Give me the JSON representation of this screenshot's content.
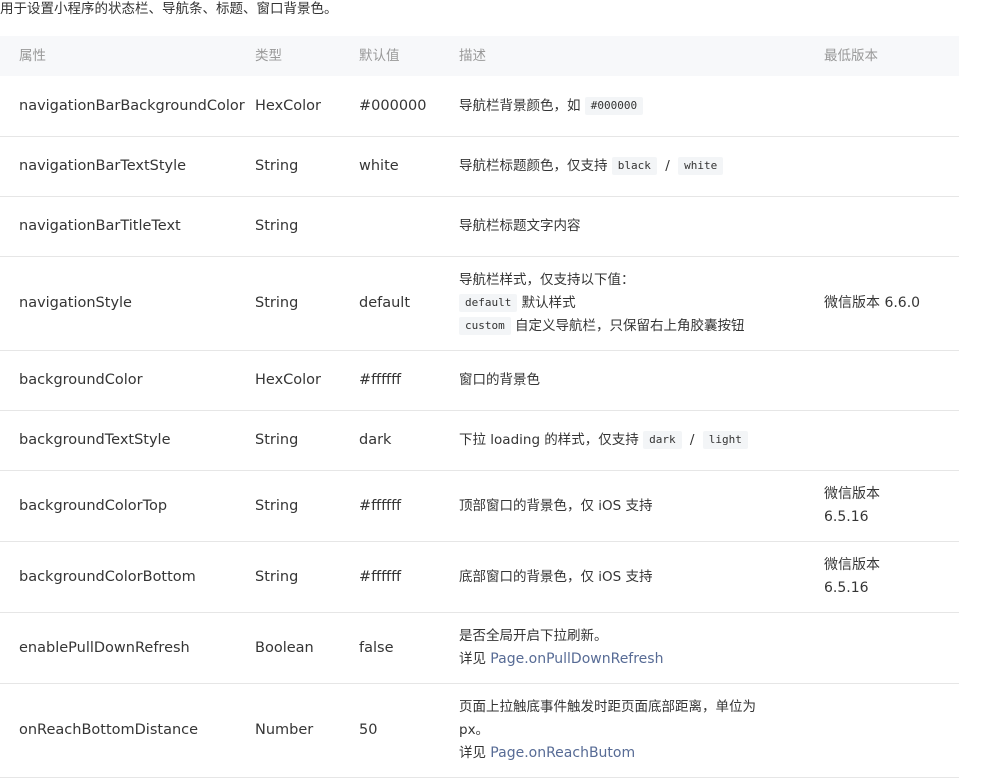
{
  "intro": "用于设置小程序的状态栏、导航条、标题、窗口背景色。",
  "headers": {
    "prop": "属性",
    "type": "类型",
    "default": "默认值",
    "desc": "描述",
    "version": "最低版本"
  },
  "rows": [
    {
      "prop": "navigationBarBackgroundColor",
      "type": "HexColor",
      "default": "#000000",
      "desc_text": "导航栏背景颜色，如",
      "desc_code": "#000000",
      "version": ""
    },
    {
      "prop": "navigationBarTextStyle",
      "type": "String",
      "default": "white",
      "desc_text": "导航栏标题颜色，仅支持",
      "desc_code1": "black",
      "desc_sep": "/",
      "desc_code2": "white",
      "version": ""
    },
    {
      "prop": "navigationBarTitleText",
      "type": "String",
      "default": "",
      "desc_text": "导航栏标题文字内容",
      "version": ""
    },
    {
      "prop": "navigationStyle",
      "type": "String",
      "default": "default",
      "desc_line1": "导航栏样式，仅支持以下值：",
      "desc_code1": "default",
      "desc_text1": "默认样式",
      "desc_code2": "custom",
      "desc_text2": "自定义导航栏，只保留右上角胶囊按钮",
      "version": "微信版本 6.6.0"
    },
    {
      "prop": "backgroundColor",
      "type": "HexColor",
      "default": "#ffffff",
      "desc_text": "窗口的背景色",
      "version": ""
    },
    {
      "prop": "backgroundTextStyle",
      "type": "String",
      "default": "dark",
      "desc_text": "下拉 loading 的样式，仅支持",
      "desc_code1": "dark",
      "desc_sep": "/",
      "desc_code2": "light",
      "version": ""
    },
    {
      "prop": "backgroundColorTop",
      "type": "String",
      "default": "#ffffff",
      "desc_text": "顶部窗口的背景色，仅 iOS 支持",
      "version_line1": "微信版本",
      "version_line2": "6.5.16"
    },
    {
      "prop": "backgroundColorBottom",
      "type": "String",
      "default": "#ffffff",
      "desc_text": "底部窗口的背景色，仅 iOS 支持",
      "version_line1": "微信版本",
      "version_line2": "6.5.16"
    },
    {
      "prop": "enablePullDownRefresh",
      "type": "Boolean",
      "default": "false",
      "desc_line1": "是否全局开启下拉刷新。",
      "desc_prefix": "详见",
      "desc_link": "Page.onPullDownRefresh",
      "version": ""
    },
    {
      "prop": "onReachBottomDistance",
      "type": "Number",
      "default": "50",
      "desc_line1": "页面上拉触底事件触发时距页面底部距离，单位为",
      "desc_line2": "px。",
      "desc_prefix": "详见",
      "desc_link": "Page.onReachButom",
      "version": ""
    }
  ],
  "colors": {
    "link": "#576b95",
    "header_bg": "#f7f8fa",
    "border": "#e6e6e6"
  }
}
